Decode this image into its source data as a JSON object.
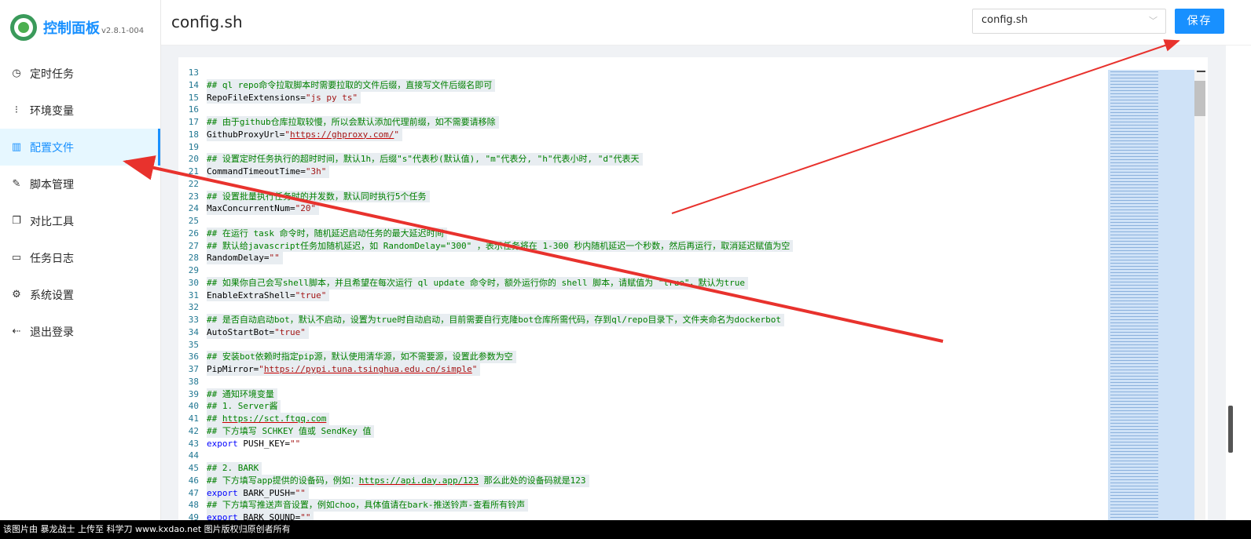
{
  "app": {
    "title": "控制面板",
    "version": "v2.8.1-004"
  },
  "sidebar": {
    "items": [
      {
        "icon": "clock-icon",
        "label": "定时任务"
      },
      {
        "icon": "variable-icon",
        "label": "环境变量"
      },
      {
        "icon": "config-icon",
        "label": "配置文件",
        "active": true
      },
      {
        "icon": "edit-icon",
        "label": "脚本管理"
      },
      {
        "icon": "diff-icon",
        "label": "对比工具"
      },
      {
        "icon": "folder-icon",
        "label": "任务日志"
      },
      {
        "icon": "gear-icon",
        "label": "系统设置"
      },
      {
        "icon": "logout-icon",
        "label": "退出登录"
      }
    ]
  },
  "header": {
    "title": "config.sh",
    "file_select": "config.sh",
    "save_label": "保存"
  },
  "editor": {
    "lines": [
      {
        "n": "13",
        "segs": []
      },
      {
        "n": "14",
        "hl": true,
        "segs": [
          {
            "t": "## ql repo命令拉取脚本时需要拉取的文件后缀，直接写文件后缀名即可",
            "c": "cm"
          }
        ]
      },
      {
        "n": "15",
        "hl": true,
        "segs": [
          {
            "t": "RepoFileExtensions="
          },
          {
            "t": "\"js py ts\"",
            "c": "st"
          }
        ]
      },
      {
        "n": "16",
        "segs": []
      },
      {
        "n": "17",
        "hl": true,
        "segs": [
          {
            "t": "## 由于github仓库拉取较慢，所以会默认添加代理前缀，如不需要请移除",
            "c": "cm"
          }
        ]
      },
      {
        "n": "18",
        "hl": true,
        "segs": [
          {
            "t": "GithubProxyUrl="
          },
          {
            "t": "\"",
            "c": "st"
          },
          {
            "t": "https://ghproxy.com/",
            "c": "st url"
          },
          {
            "t": "\"",
            "c": "st"
          }
        ]
      },
      {
        "n": "19",
        "segs": []
      },
      {
        "n": "20",
        "hl": true,
        "segs": [
          {
            "t": "## 设置定时任务执行的超时时间，默认1h，后缀\"s\"代表秒(默认值), \"m\"代表分, \"h\"代表小时, \"d\"代表天",
            "c": "cm"
          }
        ]
      },
      {
        "n": "21",
        "hl": true,
        "segs": [
          {
            "t": "CommandTimeoutTime="
          },
          {
            "t": "\"3h\"",
            "c": "st"
          }
        ]
      },
      {
        "n": "22",
        "segs": []
      },
      {
        "n": "23",
        "hl": true,
        "segs": [
          {
            "t": "## 设置批量执行任务时的并发数，默认同时执行5个任务",
            "c": "cm"
          }
        ]
      },
      {
        "n": "24",
        "hl": true,
        "segs": [
          {
            "t": "MaxConcurrentNum="
          },
          {
            "t": "\"20\"",
            "c": "st"
          }
        ]
      },
      {
        "n": "25",
        "segs": []
      },
      {
        "n": "26",
        "hl": true,
        "segs": [
          {
            "t": "## 在运行 task 命令时，随机延迟启动任务的最大延迟时间",
            "c": "cm"
          }
        ]
      },
      {
        "n": "27",
        "hl": true,
        "segs": [
          {
            "t": "## 默认给javascript任务加随机延迟，如 RandomDelay=\"300\" ，表示任务将在 1-300 秒内随机延迟一个秒数，然后再运行，取消延迟赋值为空",
            "c": "cm"
          }
        ]
      },
      {
        "n": "28",
        "hl": true,
        "segs": [
          {
            "t": "RandomDelay="
          },
          {
            "t": "\"\"",
            "c": "st"
          }
        ]
      },
      {
        "n": "29",
        "segs": []
      },
      {
        "n": "30",
        "hl": true,
        "segs": [
          {
            "t": "## 如果你自己会写shell脚本，并且希望在每次运行 ql update 命令时，额外运行你的 shell 脚本，请赋值为 \"true\"，默认为true",
            "c": "cm"
          }
        ]
      },
      {
        "n": "31",
        "hl": true,
        "segs": [
          {
            "t": "EnableExtraShell="
          },
          {
            "t": "\"true\"",
            "c": "st"
          }
        ]
      },
      {
        "n": "32",
        "segs": []
      },
      {
        "n": "33",
        "hl": true,
        "segs": [
          {
            "t": "## 是否自动启动bot，默认不启动，设置为true时自动启动，目前需要自行克隆bot仓库所需代码，存到ql/repo目录下，文件夹命名为dockerbot",
            "c": "cm"
          }
        ]
      },
      {
        "n": "34",
        "hl": true,
        "segs": [
          {
            "t": "AutoStartBot="
          },
          {
            "t": "\"true\"",
            "c": "st"
          }
        ]
      },
      {
        "n": "35",
        "segs": []
      },
      {
        "n": "36",
        "hl": true,
        "segs": [
          {
            "t": "## 安装bot依赖时指定pip源，默认使用清华源，如不需要源，设置此参数为空",
            "c": "cm"
          }
        ]
      },
      {
        "n": "37",
        "hl": true,
        "segs": [
          {
            "t": "PipMirror="
          },
          {
            "t": "\"",
            "c": "st"
          },
          {
            "t": "https://pypi.tuna.tsinghua.edu.cn/simple",
            "c": "st url"
          },
          {
            "t": "\"",
            "c": "st"
          }
        ]
      },
      {
        "n": "38",
        "segs": []
      },
      {
        "n": "39",
        "hl": true,
        "segs": [
          {
            "t": "## 通知环境变量",
            "c": "cm"
          }
        ]
      },
      {
        "n": "40",
        "hl": true,
        "segs": [
          {
            "t": "## 1. Server酱",
            "c": "cm"
          }
        ]
      },
      {
        "n": "41",
        "hl": true,
        "segs": [
          {
            "t": "## ",
            "c": "cm"
          },
          {
            "t": "https://sct.ftqq.com",
            "c": "cm url"
          }
        ]
      },
      {
        "n": "42",
        "hl": true,
        "segs": [
          {
            "t": "## 下方填写 SCHKEY 值或 SendKey 值",
            "c": "cm"
          }
        ]
      },
      {
        "n": "43",
        "segs": [
          {
            "t": "export",
            "c": "kw"
          },
          {
            "t": " PUSH_KEY="
          },
          {
            "t": "\"\"",
            "c": "st"
          }
        ]
      },
      {
        "n": "44",
        "segs": []
      },
      {
        "n": "45",
        "hl": true,
        "segs": [
          {
            "t": "## 2. BARK",
            "c": "cm"
          }
        ]
      },
      {
        "n": "46",
        "hl": true,
        "segs": [
          {
            "t": "## 下方填写app提供的设备码，例如：",
            "c": "cm"
          },
          {
            "t": "https://api.day.app/123",
            "c": "cm url"
          },
          {
            "t": " 那么此处的设备码就是123",
            "c": "cm"
          }
        ]
      },
      {
        "n": "47",
        "hl": true,
        "segs": [
          {
            "t": "export",
            "c": "kw"
          },
          {
            "t": " BARK_PUSH="
          },
          {
            "t": "\"\"",
            "c": "st"
          }
        ]
      },
      {
        "n": "48",
        "hl": true,
        "segs": [
          {
            "t": "## 下方填写推送声音设置，例如choo，具体值请在bark-推送铃声-查看所有铃声",
            "c": "cm"
          }
        ]
      },
      {
        "n": "49",
        "hl": true,
        "segs": [
          {
            "t": "export",
            "c": "kw"
          },
          {
            "t": " BARK_SOUND="
          },
          {
            "t": "\"\"",
            "c": "st"
          }
        ]
      }
    ]
  },
  "watermark": {
    "text": "该图片由 暴龙战士 上传至 科学刀 www.kxdao.net 图片版权归原创者所有"
  },
  "colors": {
    "accent": "#1890ff",
    "arrow": "#e8322d",
    "comment": "#008000",
    "string": "#a31515",
    "keyword": "#0000ff"
  }
}
